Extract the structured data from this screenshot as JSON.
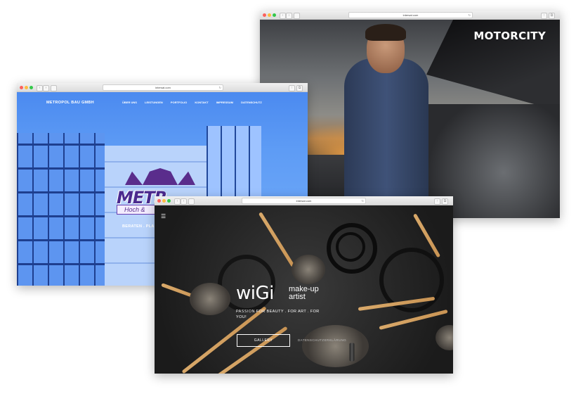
{
  "windows": {
    "motorcity": {
      "url": "intersat.com",
      "title": "MOTORCITY"
    },
    "metropol": {
      "url": "intersat.com",
      "brand": "METROPOL BAU GMBH",
      "menu": [
        "ÜBER UNS",
        "LEISTUNGEN",
        "PORTFOLIO",
        "KONTAKT",
        "IMPRESSUM",
        "DATENSCHUTZ"
      ],
      "logo_text": "METR",
      "logo_sub": "Hoch &",
      "tagline": "BERATEN . PLA"
    },
    "wigi": {
      "url": "intersat.com",
      "menu_icon": "☰",
      "logo_name": "wiGi",
      "logo_sub": "make-up artist",
      "tagline": "PASSION FOR BEAUTY . FOR ART . FOR YOU!",
      "gallery_label": "GALLERY",
      "privacy_label": "DATENSCHUTZERKLÄRUNG"
    }
  },
  "colors": {
    "close": "#fc605c",
    "minimize": "#fdbc40",
    "maximize": "#34c84a",
    "metropol_blue": "#4b8af0",
    "metropol_purple": "#4b2a8f",
    "wigi_bg": "#1b1b1b"
  }
}
